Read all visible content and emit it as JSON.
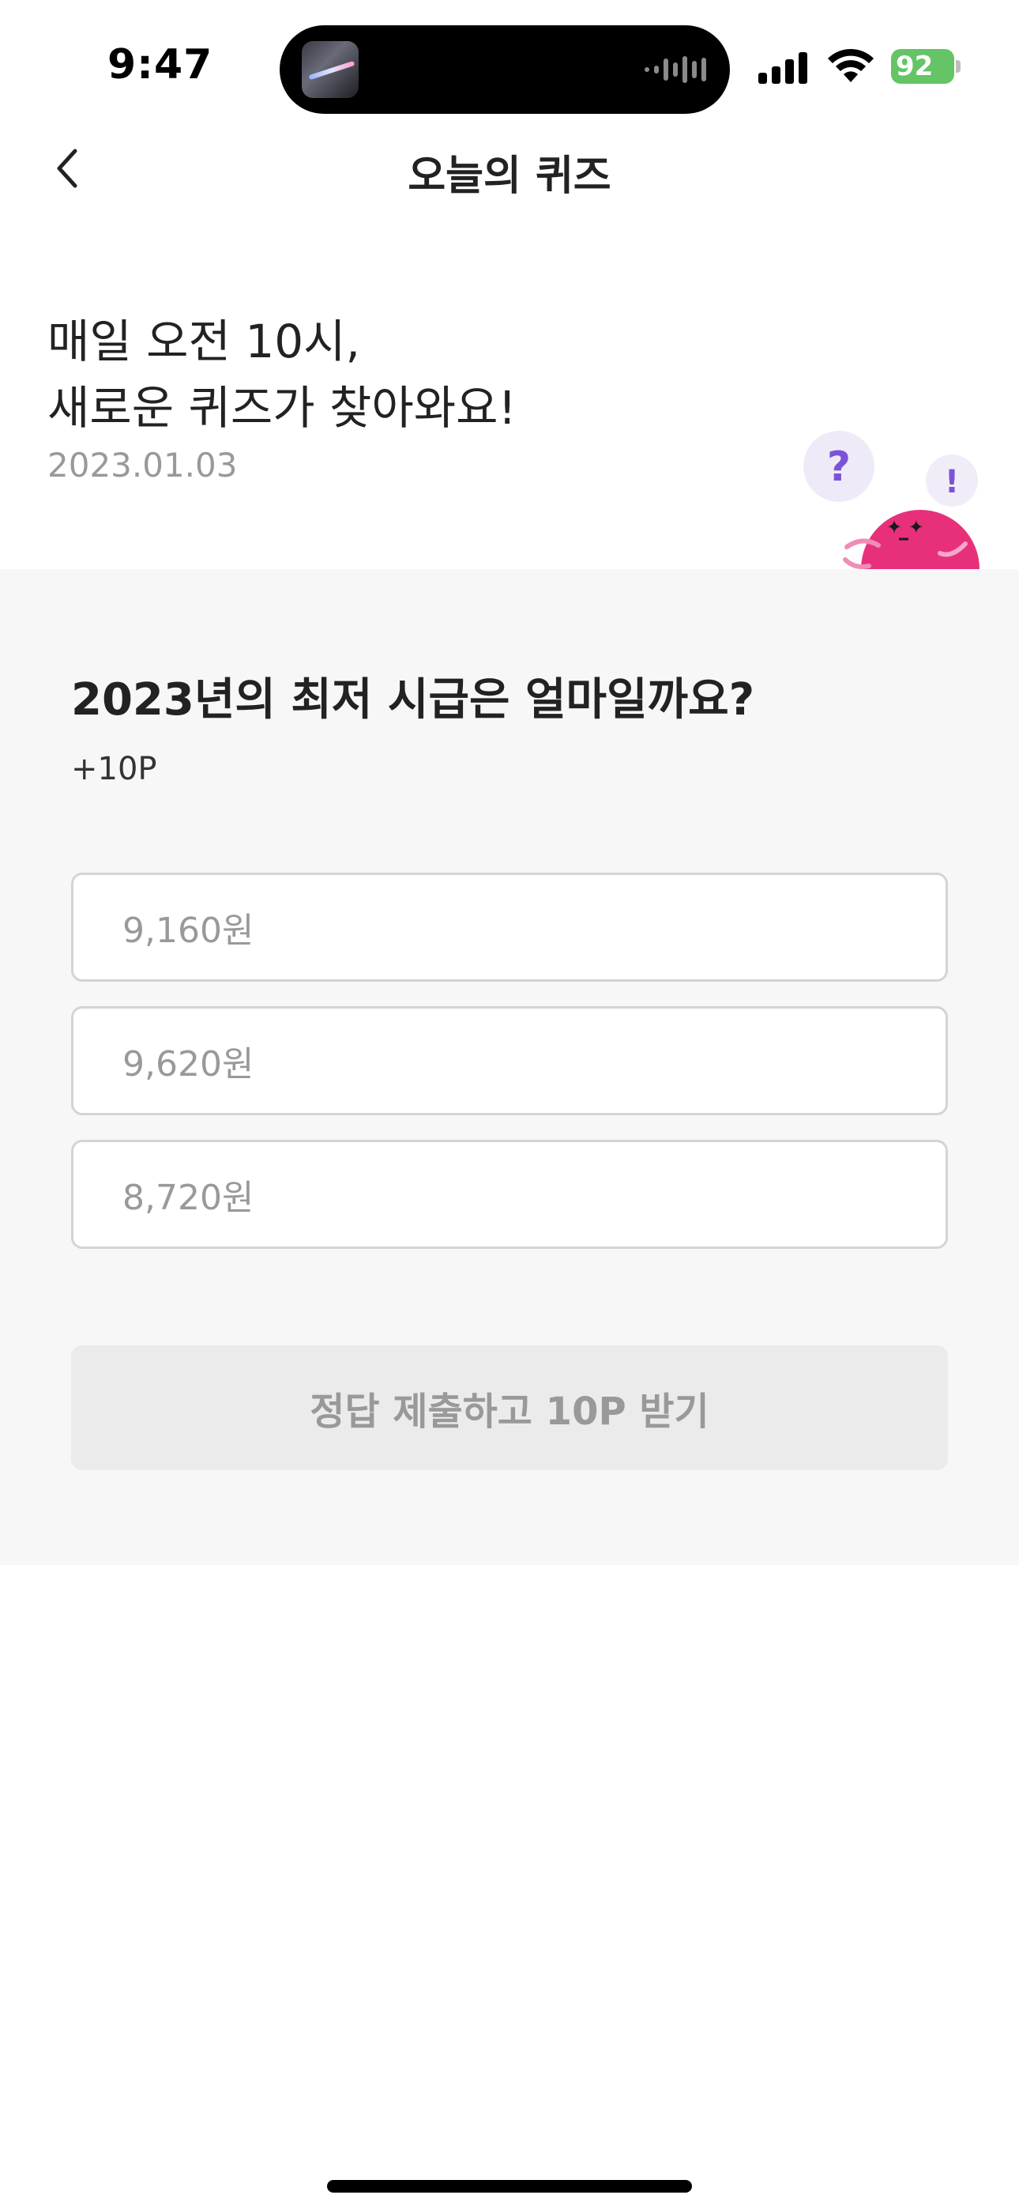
{
  "status_bar": {
    "time": "9:47",
    "battery": "92",
    "battery_color": "#65c466"
  },
  "header": {
    "back_icon": "chevron-left-icon",
    "title": "오늘의 퀴즈"
  },
  "intro": {
    "line1": "매일 오전 10시,",
    "line2": "새로운 퀴즈가 찾아와요!",
    "date": "2023.01.03"
  },
  "mascot": {
    "question_mark": "?",
    "exclamation_mark": "!",
    "color": "#e8307a",
    "bubble_color": "#efeaf8",
    "mark_color": "#7a54d6"
  },
  "quiz": {
    "question": "2023년의 최저 시급은 얼마일까요?",
    "points": "+10P",
    "options": [
      "9,160원",
      "9,620원",
      "8,720원"
    ],
    "submit_label": "정답 제출하고 10P 받기"
  }
}
